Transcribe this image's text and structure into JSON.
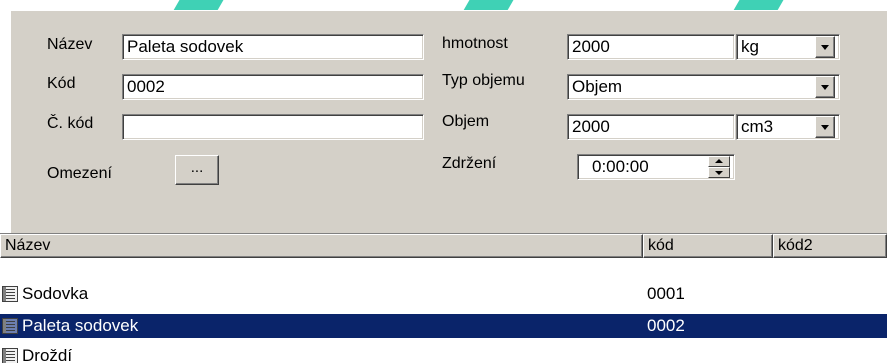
{
  "form": {
    "nazev_label": "Název",
    "nazev_value": "Paleta sodovek",
    "kod_label": "Kód",
    "kod_value": "0002",
    "ckod_label": "Č. kód",
    "ckod_value": "",
    "omezeni_label": "Omezení",
    "omezeni_button": "...",
    "hmotnost_label": "hmotnost",
    "hmotnost_value": "2000",
    "hmotnost_unit": "kg",
    "typ_objemu_label": "Typ objemu",
    "typ_objemu_value": "Objem",
    "objem_label": "Objem",
    "objem_value": "2000",
    "objem_unit": "cm3",
    "zdrzeni_label": "Zdržení",
    "zdrzeni_value": "0:00:00"
  },
  "list": {
    "columns": [
      "Název",
      "kód",
      "kód2"
    ],
    "rows": [
      {
        "nazev": "Sodovka",
        "kod": "0001",
        "kod2": ""
      },
      {
        "nazev": "Paleta sodovek",
        "kod": "0002",
        "kod2": ""
      },
      {
        "nazev": "Droždí",
        "kod": "",
        "kod2": ""
      }
    ],
    "selected_row": 1
  },
  "colors": {
    "panel": "#d4d0c8",
    "selection": "#0a246a",
    "accent_stripe": "#3fd1b5"
  },
  "icons": {
    "row_icon": "table-icon",
    "combo": "chevron-down-icon",
    "spinner": "spin-arrows-icon"
  }
}
